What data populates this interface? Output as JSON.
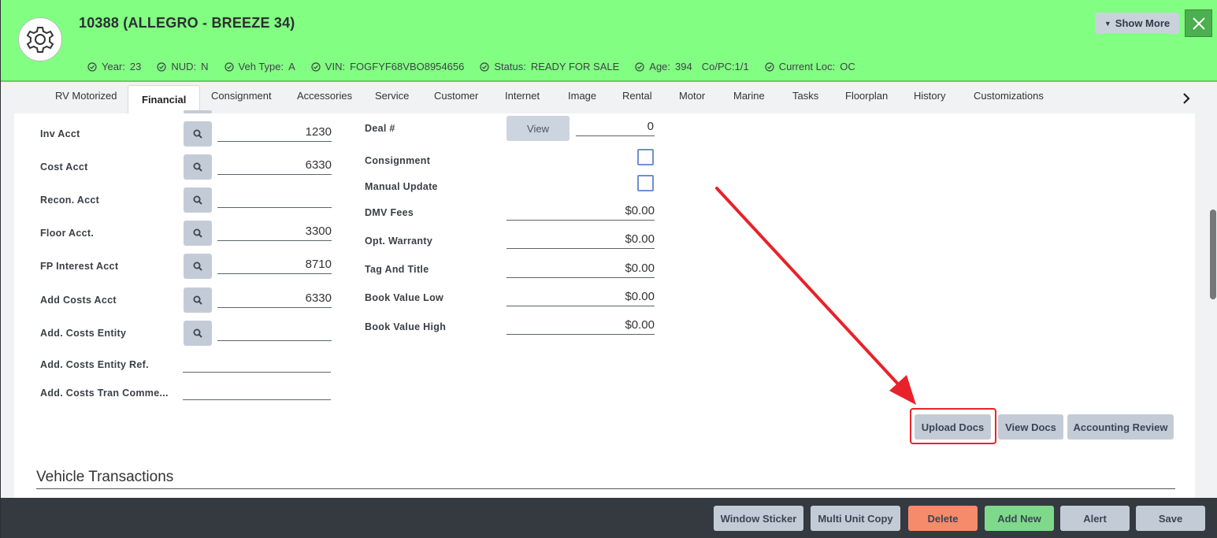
{
  "header": {
    "title": "10388 (ALLEGRO - BREEZE 34)",
    "show_more": "Show More",
    "info": [
      {
        "label": "Year:",
        "value": "23"
      },
      {
        "label": "NUD:",
        "value": "N"
      },
      {
        "label": "Veh Type:",
        "value": "A"
      },
      {
        "label": "VIN:",
        "value": "FOGFYF68VBO8954656"
      },
      {
        "label": "Status:",
        "value": "READY FOR SALE"
      },
      {
        "label": "Age:",
        "value": "394",
        "extra": "Co/PC:1/1"
      },
      {
        "label": "Current Loc:",
        "value": "OC"
      }
    ]
  },
  "tabs": [
    "RV Motorized",
    "Financial",
    "Consignment",
    "Accessories",
    "Service",
    "Customer",
    "Internet",
    "Image",
    "Rental",
    "Motor",
    "Marine",
    "Tasks",
    "Floorplan",
    "History",
    "Customizations"
  ],
  "left_fields": [
    {
      "label": "Inv Acct",
      "value": "1230"
    },
    {
      "label": "Cost Acct",
      "value": "6330"
    },
    {
      "label": "Recon. Acct",
      "value": ""
    },
    {
      "label": "Floor Acct.",
      "value": "3300"
    },
    {
      "label": "FP Interest Acct",
      "value": "8710"
    },
    {
      "label": "Add Costs Acct",
      "value": "6330"
    },
    {
      "label": "Add. Costs Entity",
      "value": ""
    },
    {
      "label": "Add. Costs Entity Ref.",
      "value": ""
    },
    {
      "label": "Add. Costs Tran Comme...",
      "value": ""
    }
  ],
  "middle": {
    "deal_label": "Deal #",
    "view_label": "View",
    "deal_value": "0",
    "consignment_label": "Consignment",
    "manual_update_label": "Manual Update",
    "money_fields": [
      {
        "label": "DMV Fees",
        "value": "$0.00"
      },
      {
        "label": "Opt. Warranty",
        "value": "$0.00"
      },
      {
        "label": "Tag And Title",
        "value": "$0.00"
      },
      {
        "label": "Book Value Low",
        "value": "$0.00"
      },
      {
        "label": "Book Value High",
        "value": "$0.00"
      }
    ]
  },
  "doc_buttons": {
    "upload": "Upload Docs",
    "view": "View Docs",
    "review": "Accounting Review"
  },
  "section_title": "Vehicle Transactions",
  "footer": {
    "window_sticker": "Window Sticker",
    "multi_unit_copy": "Multi Unit Copy",
    "delete": "Delete",
    "add_new": "Add New",
    "alert": "Alert",
    "save": "Save"
  },
  "colors": {
    "header_bg": "#82ff82",
    "delete_bg": "#f58b6b",
    "add_new_bg": "#7fd98a",
    "annotation_red": "#e8222b"
  },
  "icons": [
    "gear-icon",
    "check-circle-icon",
    "caret-down-icon",
    "close-icon",
    "chevron-right-icon",
    "search-icon"
  ]
}
